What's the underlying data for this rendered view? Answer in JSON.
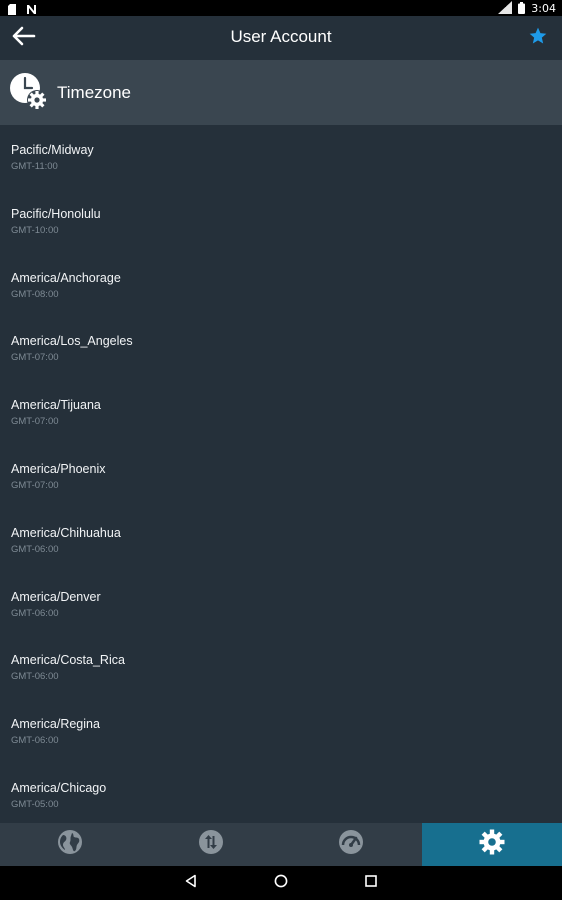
{
  "status_bar": {
    "time": "3:04",
    "left_icons": [
      "sd-card-icon",
      "n-notification-icon"
    ],
    "right_icons": [
      "lte-signal-icon",
      "battery-icon"
    ]
  },
  "app_bar": {
    "title": "User Account",
    "back_icon": "arrow-left-icon",
    "star_icon": "star-icon",
    "star_color": "#1e9be9"
  },
  "section": {
    "title": "Timezone",
    "icon": "clock-gear-icon"
  },
  "timezones": [
    {
      "name": "Pacific/Midway",
      "offset": "GMT-11:00"
    },
    {
      "name": "Pacific/Honolulu",
      "offset": "GMT-10:00"
    },
    {
      "name": "America/Anchorage",
      "offset": "GMT-08:00"
    },
    {
      "name": "America/Los_Angeles",
      "offset": "GMT-07:00"
    },
    {
      "name": "America/Tijuana",
      "offset": "GMT-07:00"
    },
    {
      "name": "America/Phoenix",
      "offset": "GMT-07:00"
    },
    {
      "name": "America/Chihuahua",
      "offset": "GMT-06:00"
    },
    {
      "name": "America/Denver",
      "offset": "GMT-06:00"
    },
    {
      "name": "America/Costa_Rica",
      "offset": "GMT-06:00"
    },
    {
      "name": "America/Regina",
      "offset": "GMT-06:00"
    },
    {
      "name": "America/Chicago",
      "offset": "GMT-05:00"
    }
  ],
  "tabs": [
    {
      "icon": "globe-icon",
      "active": false
    },
    {
      "icon": "transfer-arrows-icon",
      "active": false
    },
    {
      "icon": "speedometer-icon",
      "active": false
    },
    {
      "icon": "gear-icon",
      "active": true
    }
  ],
  "colors": {
    "background": "#25303a",
    "header": "#3a4650",
    "tab_bar": "#323d47",
    "tab_active": "#176f8f"
  },
  "nav_bar": {
    "buttons": [
      "back-triangle-icon",
      "home-circle-icon",
      "recents-square-icon"
    ]
  }
}
